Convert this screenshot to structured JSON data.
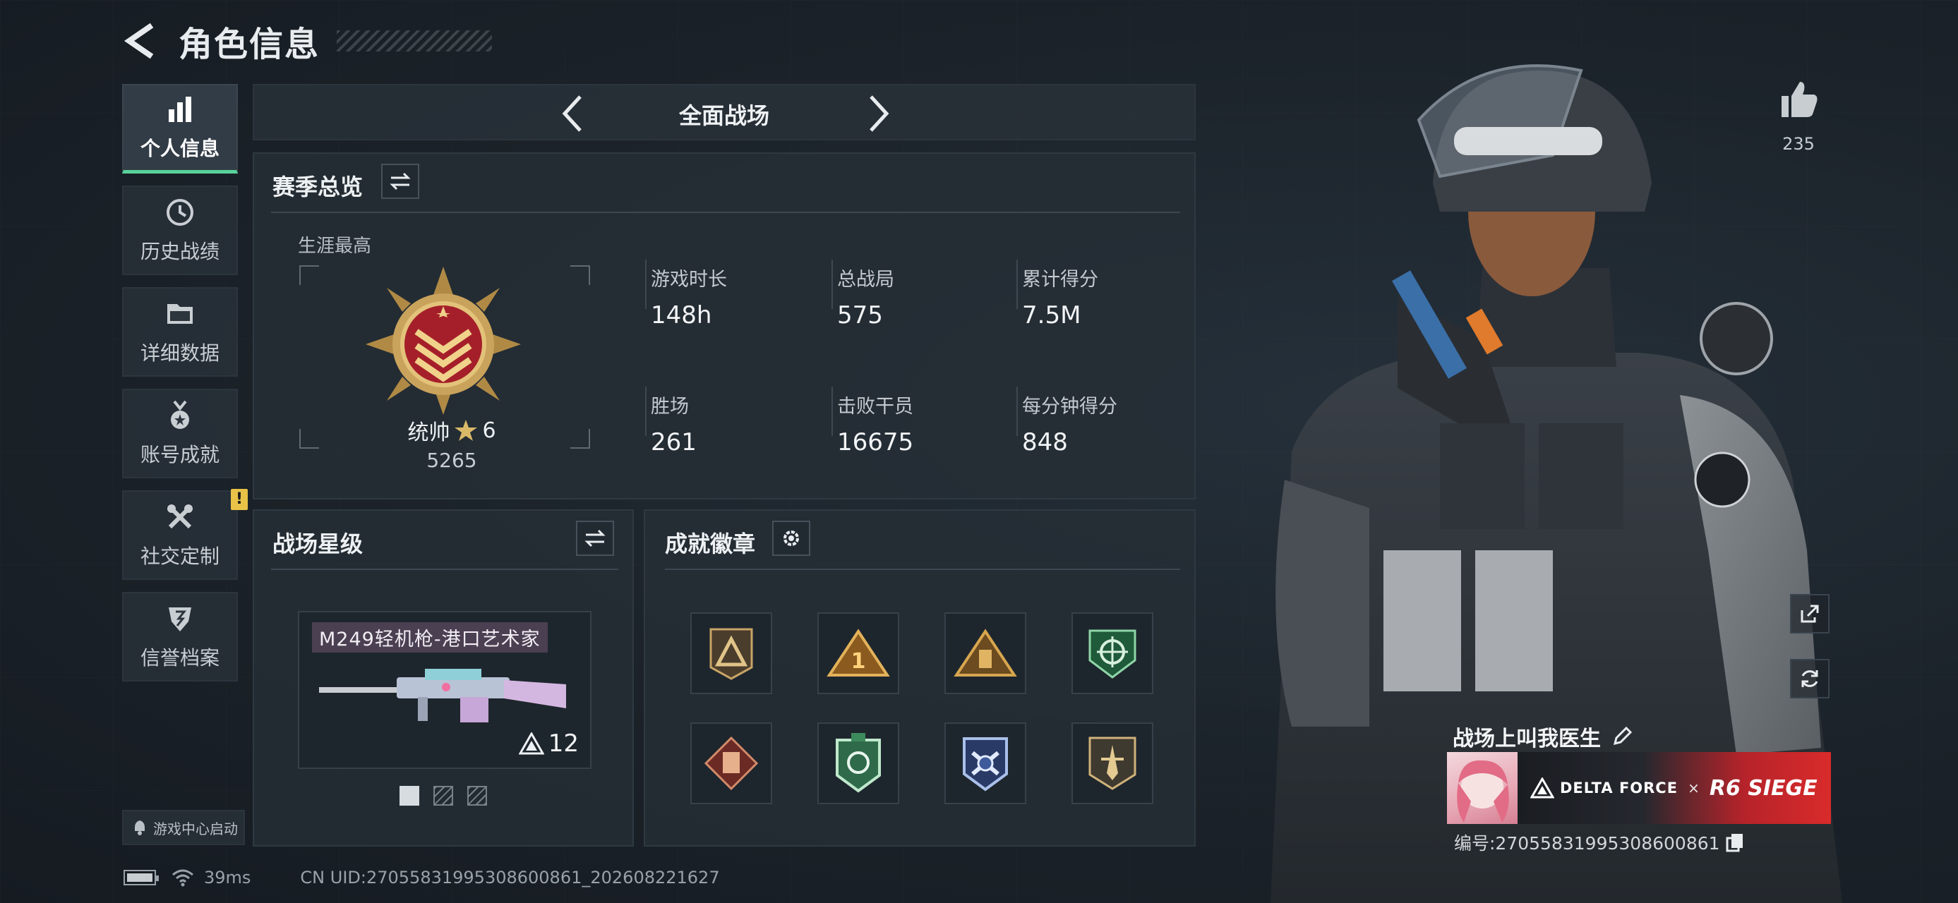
{
  "header": {
    "title": "角色信息"
  },
  "sidebar": {
    "items": [
      {
        "label": "个人信息",
        "icon": "bar-chart-icon",
        "active": true
      },
      {
        "label": "历史战绩",
        "icon": "history-clock-icon",
        "active": false
      },
      {
        "label": "详细数据",
        "icon": "folder-icon",
        "active": false
      },
      {
        "label": "账号成就",
        "icon": "achievement-medal-icon",
        "active": false
      },
      {
        "label": "社交定制",
        "icon": "tools-icon",
        "active": false,
        "badge": "!"
      },
      {
        "label": "信誉档案",
        "icon": "shield-emblem-icon",
        "active": false
      }
    ],
    "launch_label": "游戏中心启动"
  },
  "mode_bar": {
    "title": "全面战场"
  },
  "season_overview": {
    "title": "赛季总览",
    "career_label": "生涯最高",
    "rank_name": "统帅",
    "rank_stars": "6",
    "rank_points": "5265",
    "stats": [
      {
        "label": "游戏时长",
        "value": "148h"
      },
      {
        "label": "总战局",
        "value": "575"
      },
      {
        "label": "累计得分",
        "value": "7.5M"
      },
      {
        "label": "胜场",
        "value": "261"
      },
      {
        "label": "击败干员",
        "value": "16675"
      },
      {
        "label": "每分钟得分",
        "value": "848"
      }
    ]
  },
  "battlefield_star": {
    "title": "战场星级",
    "weapon_name": "M249轻机枪-港口艺术家",
    "weapon_level": "12",
    "pages": 3,
    "current_page": 1
  },
  "achievement_badges": {
    "title": "成就徽章",
    "badges": [
      "triangle-insignia",
      "number-one-insignia",
      "pyramid-insignia",
      "green-crosshair-badge",
      "red-gear-badge",
      "green-shield-badge",
      "blue-cross-badge",
      "dagger-insignia"
    ]
  },
  "profile": {
    "likes": "235",
    "player_name": "战场上叫我医生",
    "banner_brand_1": "DELTA FORCE",
    "banner_x": "×",
    "banner_brand_2": "R6 SIEGE",
    "player_id": "编号:2705583199530860​0861"
  },
  "footer": {
    "ping": "39ms",
    "uid": "CN UID:2705583199530860​0861_202608221627"
  },
  "colors": {
    "accent": "#59d39a",
    "alert": "#e8c347",
    "banner_red": "#d92b2b"
  }
}
